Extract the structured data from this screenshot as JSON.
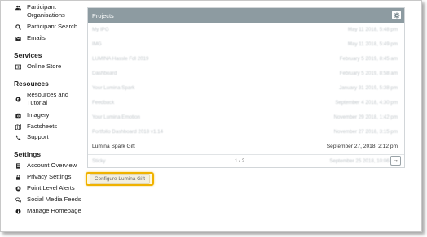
{
  "sidebar": {
    "top_items": [
      {
        "label": "Participant Organisations",
        "icon": "users-icon"
      },
      {
        "label": "Participant Search",
        "icon": "search-icon"
      },
      {
        "label": "Emails",
        "icon": "envelope-icon"
      }
    ],
    "services": {
      "title": "Services",
      "items": [
        {
          "label": "Online Store",
          "icon": "store-icon"
        }
      ]
    },
    "resources": {
      "title": "Resources",
      "items": [
        {
          "label": "Resources and Tutorial",
          "icon": "globe-icon"
        },
        {
          "label": "Imagery",
          "icon": "camera-icon"
        },
        {
          "label": "Factsheets",
          "icon": "map-icon"
        },
        {
          "label": "Support",
          "icon": "phone-icon"
        }
      ]
    },
    "settings": {
      "title": "Settings",
      "items": [
        {
          "label": "Account Overview",
          "icon": "document-icon"
        },
        {
          "label": "Privacy Settings",
          "icon": "lock-icon"
        },
        {
          "label": "Point Level Alerts",
          "icon": "bell-icon"
        },
        {
          "label": "Social Media Feeds",
          "icon": "comments-icon"
        },
        {
          "label": "Manage Homepage",
          "icon": "info-icon"
        }
      ]
    }
  },
  "projects": {
    "title": "Projects",
    "rows": [
      {
        "name": "My IPG",
        "date": "May 11 2018, 5:48 pm",
        "obscured": true
      },
      {
        "name": "IMG",
        "date": "May 11 2018, 5:49 pm",
        "obscured": true
      },
      {
        "name": "LUMINA Hassle Fdl 2019",
        "date": "February 5 2019, 8:45 am",
        "obscured": true
      },
      {
        "name": "Dashboard",
        "date": "February 5 2019, 8:58 am",
        "obscured": true
      },
      {
        "name": "Your Lumina Spark",
        "date": "January 31 2019, 5:38 pm",
        "obscured": true
      },
      {
        "name": "Feedback",
        "date": "September 4 2018, 4:30 pm",
        "obscured": true
      },
      {
        "name": "Your Lumina Emotion",
        "date": "November 29 2018, 1:42 pm",
        "obscured": true
      },
      {
        "name": "Portfolio Dashboard 2018 v1.14",
        "date": "November 27 2018, 3:15 pm",
        "obscured": true
      },
      {
        "name": "Lumina Spark Gift",
        "date": "September 27, 2018, 2:12 pm",
        "obscured": false
      },
      {
        "name": "Sticky",
        "date": "September 25 2018, 10:06 am",
        "obscured": true
      }
    ],
    "page_indicator": "1 / 2",
    "next_label": "→"
  },
  "action_button": {
    "label": "Configure Lumina Gift"
  },
  "colors": {
    "panel_header": "#8d9ba1",
    "highlight": "#f0b200"
  }
}
